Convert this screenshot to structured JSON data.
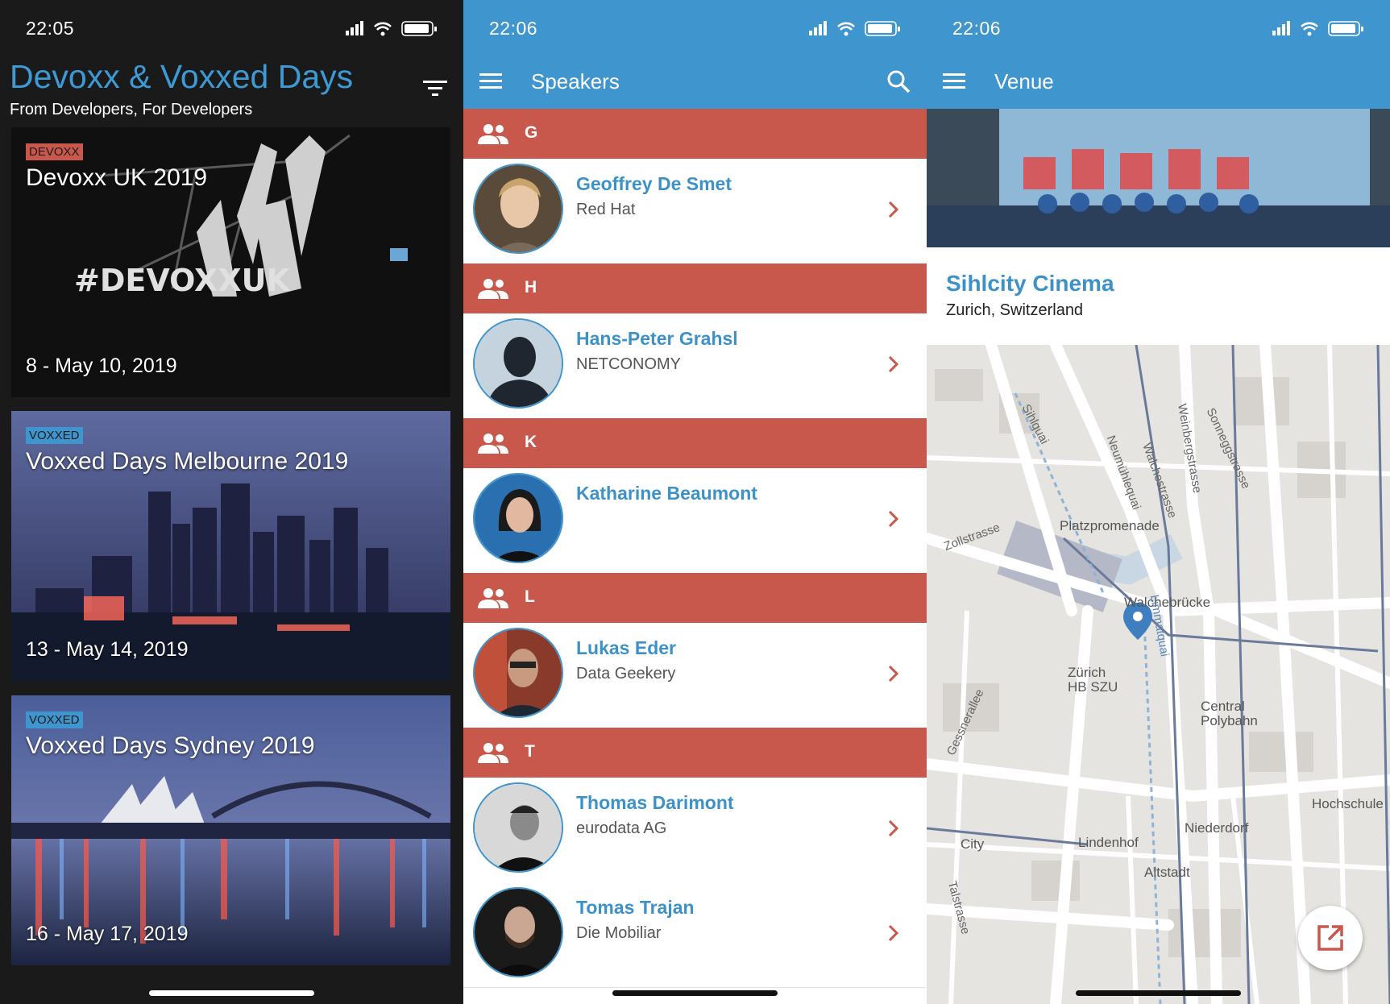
{
  "colors": {
    "brand_blue": "#3f95cd",
    "section_red": "#c8574c",
    "title_blue": "#3c9ad6",
    "dark_bg": "#1a1a1a"
  },
  "screen1": {
    "status_time": "22:05",
    "title": "Devoxx & Voxxed Days",
    "subtitle": "From Developers, For Developers",
    "filter_icon": "filter-icon",
    "events": [
      {
        "tag": "DEVOXX",
        "title": "Devoxx UK 2019",
        "date": "8 - May 10, 2019",
        "sign_text": "#DEVOXXUK"
      },
      {
        "tag": "VOXXED",
        "title": "Voxxed Days Melbourne 2019",
        "date": "13 - May 14, 2019"
      },
      {
        "tag": "VOXXED",
        "title": "Voxxed Days Sydney 2019",
        "date": "16 - May 17, 2019"
      }
    ]
  },
  "screen2": {
    "status_time": "22:06",
    "title": "Speakers",
    "sections": [
      {
        "letter": "G",
        "speakers": [
          {
            "name": "Geoffrey De Smet",
            "company": "Red Hat"
          }
        ]
      },
      {
        "letter": "H",
        "speakers": [
          {
            "name": "Hans-Peter Grahsl",
            "company": "NETCONOMY"
          }
        ]
      },
      {
        "letter": "K",
        "speakers": [
          {
            "name": "Katharine Beaumont",
            "company": ""
          }
        ]
      },
      {
        "letter": "L",
        "speakers": [
          {
            "name": "Lukas Eder",
            "company": "Data Geekery"
          }
        ]
      },
      {
        "letter": "T",
        "speakers": [
          {
            "name": "Thomas Darimont",
            "company": "eurodata AG"
          },
          {
            "name": "Tomas Trajan",
            "company": "Die Mobiliar"
          }
        ]
      }
    ]
  },
  "screen3": {
    "status_time": "22:06",
    "title": "Venue",
    "venue_name": "Sihlcity Cinema",
    "venue_address": "Zurich, Switzerland",
    "map_labels": [
      "Platzpromenade",
      "Walchebrücke",
      "Zürich HB SZU",
      "Central Polybahn",
      "Niederdorf",
      "Lindenhof",
      "Altstadt",
      "City",
      "Hochschule",
      "Zollstrasse",
      "Sihlquai",
      "Neumühlequai",
      "Walchestrasse",
      "Weinbergstrasse",
      "Sonneggstrasse",
      "Limmatquai",
      "Gessnerallee",
      "Talstrasse"
    ]
  }
}
